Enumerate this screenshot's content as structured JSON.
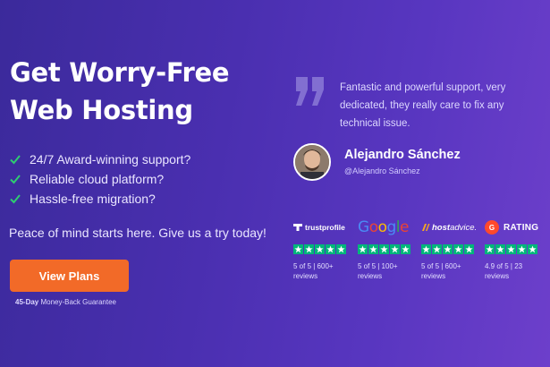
{
  "hero": {
    "headline": "Get Worry-Free Web Hosting",
    "features": [
      "24/7 Award-winning support?",
      "Reliable cloud platform?",
      "Hassle-free migration?"
    ],
    "tagline": "Peace of mind starts here. Give us a try today!",
    "cta_label": "View Plans",
    "guarantee_bold": "45-Day",
    "guarantee_rest": " Money-Back Guarantee"
  },
  "testimonial": {
    "quote": "Fantastic and powerful support, very dedicated, they really care to fix any technical issue.",
    "author_name": "Alejandro Sánchez",
    "author_handle": "@Alejandro Sánchez"
  },
  "ratings": [
    {
      "source": "trustprofile",
      "logo_text": "trustprofile",
      "score": "5 of 5 | 600+",
      "reviews": "reviews",
      "stars": 5
    },
    {
      "source": "google",
      "logo_text": "Google",
      "score": "5 of 5 | 100+",
      "reviews": "reviews",
      "stars": 5
    },
    {
      "source": "hostadvice",
      "logo_text_bold": "host",
      "logo_text_rest": "advice.",
      "score": "5 of 5 | 600+",
      "reviews": "reviews",
      "stars": 5
    },
    {
      "source": "g2",
      "logo_mark": "G",
      "logo_text": "RATING",
      "score": "4.9 of 5 | 23",
      "reviews": "reviews",
      "stars": 4.9
    }
  ],
  "colors": {
    "background_start": "#3b2a9b",
    "background_end": "#6d3fcb",
    "cta": "#f26a28",
    "check": "#2ecc71",
    "star_fill": "#00b67a",
    "g2_red": "#ff492c"
  },
  "icons": {
    "feature_check": "check-icon",
    "quote": "quote-icon",
    "star": "star-icon"
  }
}
